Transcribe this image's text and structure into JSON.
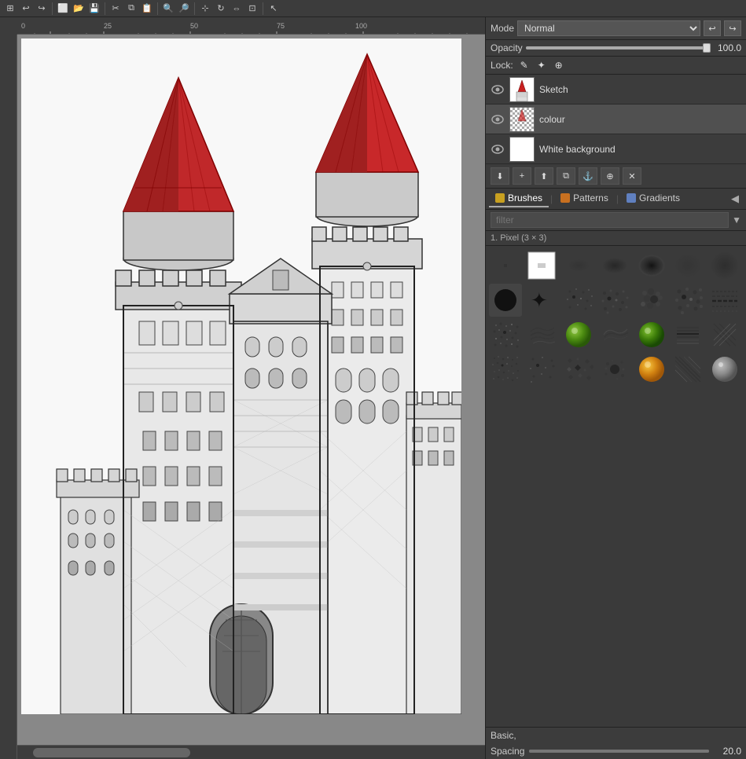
{
  "toolbar": {
    "icons": [
      "⊞",
      "↩",
      "↪",
      "⊡",
      "⊟",
      "⊠",
      "⊞",
      "◫",
      "⊕",
      "⊗",
      "✎",
      "🖊",
      "⬡",
      "⬢",
      "○",
      "▷",
      "◯",
      "⊹",
      "✦",
      "→"
    ]
  },
  "mode_bar": {
    "label": "Mode",
    "value": "Normal",
    "undo_label": "↩",
    "redo_label": "↪"
  },
  "opacity_bar": {
    "label": "Opacity",
    "value": "100.0"
  },
  "lock_bar": {
    "label": "Lock:"
  },
  "layers": [
    {
      "name": "Sketch",
      "visible": true,
      "type": "sketch",
      "active": false
    },
    {
      "name": "colour",
      "visible": true,
      "type": "colour",
      "active": true
    },
    {
      "name": "White background",
      "visible": true,
      "type": "white",
      "active": false
    }
  ],
  "brushes_panel": {
    "tabs": [
      {
        "label": "Brushes",
        "icon_color": "#c8a020",
        "active": true
      },
      {
        "label": "Patterns",
        "icon_color": "#c87020",
        "active": false
      },
      {
        "label": "Gradients",
        "icon_color": "#6080c0",
        "active": false
      }
    ],
    "filter_placeholder": "filter",
    "group_label": "1. Pixel (3 × 3)"
  },
  "bottom_bar": {
    "label": "Basic,",
    "spacing_label": "Spacing",
    "spacing_value": "20.0"
  },
  "ruler": {
    "h_marks": [
      "0",
      "25",
      "50",
      "75",
      "100"
    ],
    "v_marks": []
  }
}
